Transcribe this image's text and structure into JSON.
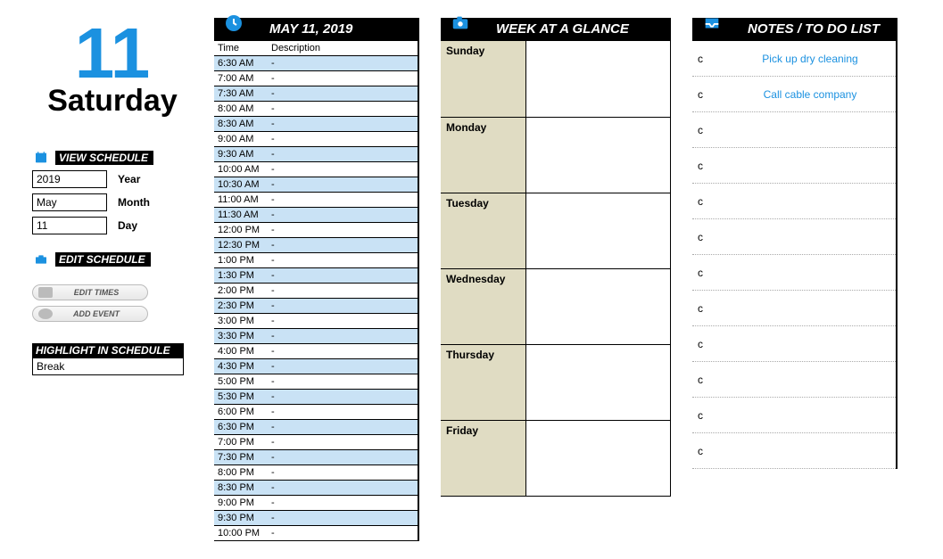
{
  "date": {
    "day_number": "11",
    "day_of_week": "Saturday",
    "full": "MAY 11,  2019"
  },
  "view_schedule": {
    "title": "VIEW SCHEDULE",
    "year": {
      "value": "2019",
      "label": "Year"
    },
    "month": {
      "value": "May",
      "label": "Month"
    },
    "day": {
      "value": "11",
      "label": "Day"
    }
  },
  "edit_schedule": {
    "title": "EDIT SCHEDULE",
    "edit_times": "EDIT TIMES",
    "add_event": "ADD  EVENT"
  },
  "highlight": {
    "title": "HIGHLIGHT IN SCHEDULE",
    "value": "Break"
  },
  "schedule": {
    "headers": {
      "time": "Time",
      "desc": "Description"
    },
    "rows": [
      {
        "time": "6:30 AM",
        "desc": "-",
        "alt": true
      },
      {
        "time": "7:00 AM",
        "desc": "-",
        "alt": false
      },
      {
        "time": "7:30 AM",
        "desc": "-",
        "alt": true
      },
      {
        "time": "8:00 AM",
        "desc": "-",
        "alt": false
      },
      {
        "time": "8:30 AM",
        "desc": "-",
        "alt": true
      },
      {
        "time": "9:00 AM",
        "desc": "-",
        "alt": false
      },
      {
        "time": "9:30 AM",
        "desc": "-",
        "alt": true
      },
      {
        "time": "10:00 AM",
        "desc": "-",
        "alt": false
      },
      {
        "time": "10:30 AM",
        "desc": "-",
        "alt": true
      },
      {
        "time": "11:00 AM",
        "desc": "-",
        "alt": false
      },
      {
        "time": "11:30 AM",
        "desc": "-",
        "alt": true
      },
      {
        "time": "12:00 PM",
        "desc": "-",
        "alt": false
      },
      {
        "time": "12:30 PM",
        "desc": "-",
        "alt": true
      },
      {
        "time": "1:00 PM",
        "desc": "-",
        "alt": false
      },
      {
        "time": "1:30 PM",
        "desc": "-",
        "alt": true
      },
      {
        "time": "2:00 PM",
        "desc": "-",
        "alt": false
      },
      {
        "time": "2:30 PM",
        "desc": "-",
        "alt": true
      },
      {
        "time": "3:00 PM",
        "desc": "-",
        "alt": false
      },
      {
        "time": "3:30 PM",
        "desc": "-",
        "alt": true
      },
      {
        "time": "4:00 PM",
        "desc": "-",
        "alt": false
      },
      {
        "time": "4:30 PM",
        "desc": "-",
        "alt": true
      },
      {
        "time": "5:00 PM",
        "desc": "-",
        "alt": false
      },
      {
        "time": "5:30 PM",
        "desc": "-",
        "alt": true
      },
      {
        "time": "6:00 PM",
        "desc": "-",
        "alt": false
      },
      {
        "time": "6:30 PM",
        "desc": "-",
        "alt": true
      },
      {
        "time": "7:00 PM",
        "desc": "-",
        "alt": false
      },
      {
        "time": "7:30 PM",
        "desc": "-",
        "alt": true
      },
      {
        "time": "8:00 PM",
        "desc": "-",
        "alt": false
      },
      {
        "time": "8:30 PM",
        "desc": "-",
        "alt": true
      },
      {
        "time": "9:00 PM",
        "desc": "-",
        "alt": false
      },
      {
        "time": "9:30 PM",
        "desc": "-",
        "alt": true
      },
      {
        "time": "10:00 PM",
        "desc": "-",
        "alt": false
      }
    ]
  },
  "week": {
    "title": "WEEK AT A GLANCE",
    "days": [
      "Sunday",
      "Monday",
      "Tuesday",
      "Wednesday",
      "Thursday",
      "Friday"
    ]
  },
  "notes": {
    "title": "NOTES / TO DO LIST",
    "items": [
      {
        "bullet": "c",
        "text": "Pick up dry cleaning"
      },
      {
        "bullet": "c",
        "text": "Call cable company"
      },
      {
        "bullet": "c",
        "text": ""
      },
      {
        "bullet": "c",
        "text": ""
      },
      {
        "bullet": "c",
        "text": ""
      },
      {
        "bullet": "c",
        "text": ""
      },
      {
        "bullet": "c",
        "text": ""
      },
      {
        "bullet": "c",
        "text": ""
      },
      {
        "bullet": "c",
        "text": ""
      },
      {
        "bullet": "c",
        "text": ""
      },
      {
        "bullet": "c",
        "text": ""
      },
      {
        "bullet": "c",
        "text": ""
      }
    ]
  }
}
